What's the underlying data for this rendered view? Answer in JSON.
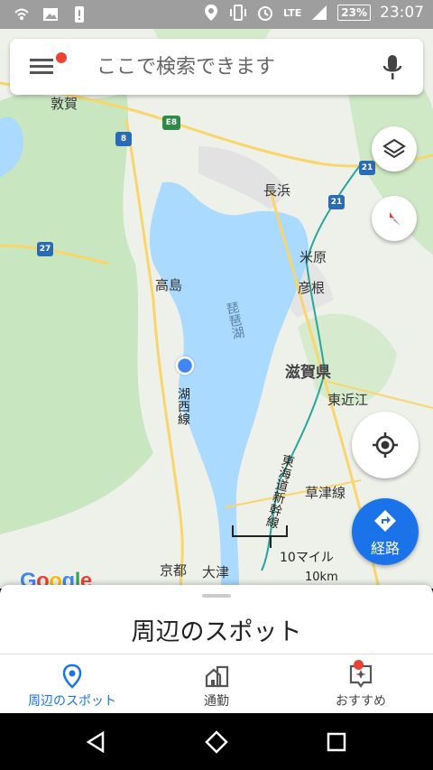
{
  "status_bar": {
    "network": "LTE",
    "battery": "23%",
    "time": "23:07",
    "left_icons": [
      "wifi-calling-icon",
      "image-icon",
      "alert-icon"
    ],
    "right_icons": [
      "location-icon",
      "vibrate-icon",
      "alarm-icon",
      "signal-icon"
    ]
  },
  "search": {
    "placeholder": "ここで検索できます"
  },
  "map": {
    "labels": {
      "tsuruga": "敦賀",
      "nagahama": "長浜",
      "takashima": "高島",
      "maibara": "米原",
      "hikone": "彦根",
      "lake": "琵琶湖",
      "shiga": "滋賀県",
      "higashiomi": "東近江",
      "kosei_line": "湖西線",
      "tokaido_shinkansen": "東海道新幹線",
      "kusatsu_line": "草津線",
      "kyoto": "京都",
      "otsu": "大津"
    },
    "shields": {
      "e8": "E8",
      "r8": "8",
      "r27": "27",
      "r21a": "21",
      "r21b": "21"
    },
    "scale": {
      "miles": "10マイル",
      "km": "10km"
    },
    "google_logo": "Google",
    "colors": {
      "water": "#aadaff",
      "land": "#eef0ea",
      "forest": "#c8e6c0",
      "road": "#f8d66c",
      "accent": "#1a73e8",
      "location_dot": "#4285f4"
    }
  },
  "route_button": {
    "label": "経路"
  },
  "sheet": {
    "title": "周辺のスポット"
  },
  "bottom_nav": {
    "items": [
      {
        "label": "周辺のスポット",
        "icon": "location-pin-icon",
        "active": true
      },
      {
        "label": "通勤",
        "icon": "commute-icon",
        "active": false
      },
      {
        "label": "おすすめ",
        "icon": "updates-icon",
        "active": false
      }
    ]
  }
}
